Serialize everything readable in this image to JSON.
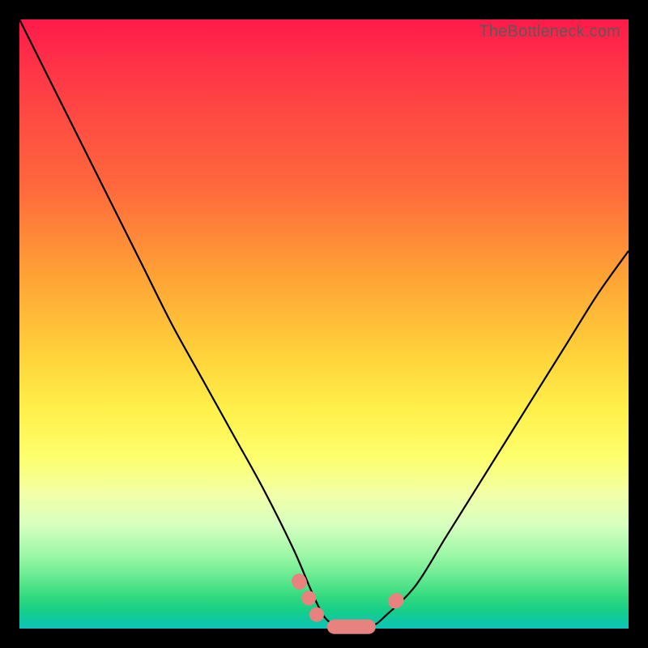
{
  "watermark": "TheBottleneck.com",
  "colors": {
    "frame": "#000000",
    "curve": "#000000",
    "markers": "#e8827e"
  },
  "chart_data": {
    "type": "line",
    "title": "",
    "xlabel": "",
    "ylabel": "",
    "xlim": [
      0,
      100
    ],
    "ylim": [
      0,
      100
    ],
    "grid": false,
    "legend": false,
    "series": [
      {
        "name": "bottleneck-curve",
        "x": [
          0,
          5,
          10,
          15,
          20,
          25,
          30,
          35,
          40,
          45,
          48,
          50,
          52,
          55,
          58,
          60,
          65,
          70,
          75,
          80,
          85,
          90,
          95,
          100
        ],
        "y": [
          100,
          90,
          80,
          70,
          60,
          50,
          41,
          32,
          23,
          13,
          6,
          2,
          0.5,
          0,
          0.5,
          2,
          7,
          15,
          23,
          31,
          39,
          47,
          55,
          62
        ]
      }
    ],
    "markers": [
      {
        "type": "pill",
        "x0": 50.5,
        "x1": 58.5,
        "y": 0.3
      },
      {
        "type": "round",
        "x": 47.5,
        "y": 5.0,
        "r": 1.4
      },
      {
        "type": "round",
        "x": 48.8,
        "y": 2.3,
        "r": 1.4
      },
      {
        "type": "pill",
        "x0": 44.8,
        "x1": 46.8,
        "y": 8.0
      },
      {
        "type": "pill",
        "x0": 60.5,
        "x1": 63.0,
        "y": 4.5
      }
    ]
  }
}
